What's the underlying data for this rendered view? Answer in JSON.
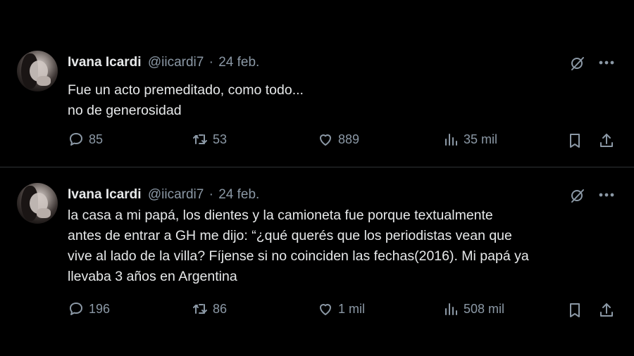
{
  "tweets": [
    {
      "author_name": "Ivana Icardi",
      "handle": "@iicardi7",
      "separator": "·",
      "date": "24 feb.",
      "lines": [
        "Fue un acto premeditado, como todo...",
        "no de generosidad"
      ],
      "replies": "85",
      "retweets": "53",
      "likes": "889",
      "views": "35 mil"
    },
    {
      "author_name": "Ivana Icardi",
      "handle": "@iicardi7",
      "separator": "·",
      "date": "24 feb.",
      "lines": [
        "la casa a mi papá, los dientes y la camioneta fue porque textualmente",
        "antes de entrar a GH me dijo: “¿qué querés que los periodistas vean que",
        "vive al lado de la villa? Fíjense si no coinciden las fechas(2016). Mi papá ya",
        "llevaba 3 años en Argentina"
      ],
      "replies": "196",
      "retweets": "86",
      "likes": "1 mil",
      "views": "508 mil"
    }
  ]
}
